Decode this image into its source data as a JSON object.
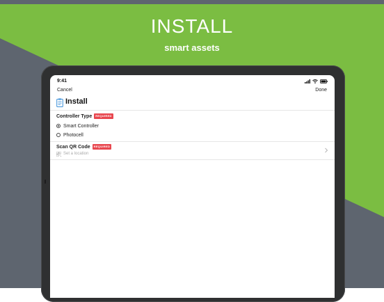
{
  "colors": {
    "band_top": "#5e656f",
    "green": "#7bbd42",
    "slate": "#5e656f",
    "badge_red": "#e8474f"
  },
  "hero": {
    "title": "INSTALL",
    "subtitle": "smart assets"
  },
  "status_bar": {
    "time": "9:41",
    "icons": [
      "signal-icon",
      "wifi-icon",
      "battery-icon"
    ]
  },
  "nav": {
    "cancel_label": "Cancel",
    "done_label": "Done"
  },
  "page": {
    "icon": "clipboard-icon",
    "title": "Install"
  },
  "form": {
    "controller_type": {
      "label": "Controller Type",
      "badge": "REQUIRED",
      "selected": "Smart Controller",
      "options": [
        {
          "label": "Smart Controller",
          "checked": true
        },
        {
          "label": "Photocell",
          "checked": false
        }
      ]
    },
    "scan_qr": {
      "label": "Scan QR Code",
      "badge": "REQUIRED",
      "placeholder": "Set a location",
      "icon": "qr-code-icon",
      "trailing_icon": "chevron-right-icon"
    }
  }
}
